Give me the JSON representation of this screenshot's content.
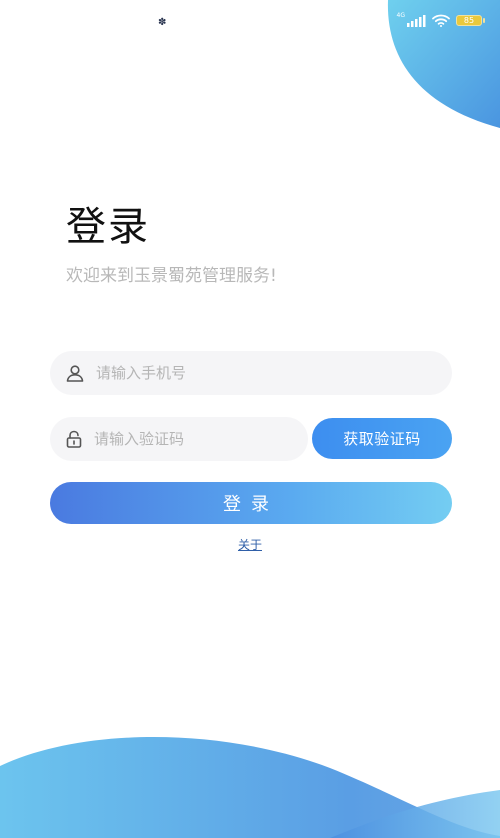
{
  "status_bar": {
    "left_indicator": "✽",
    "network_label": "4G",
    "battery_level": "85",
    "icons": [
      "signal-icon",
      "wifi-icon",
      "battery-icon"
    ]
  },
  "login": {
    "title": "登录",
    "subtitle": "欢迎来到玉景蜀苑管理服务!",
    "phone_field": {
      "placeholder": "请输入手机号",
      "value": "",
      "icon": "user-icon"
    },
    "code_field": {
      "placeholder": "请输入验证码",
      "value": "",
      "icon": "lock-icon"
    },
    "get_code_label": "获取验证码",
    "login_label": "登录",
    "about_label": "关于"
  },
  "colors": {
    "accent": "#3d8ef0",
    "gradient_start": "#4a7ae0",
    "gradient_end": "#74cdf2",
    "link": "#2f5fa8",
    "battery": "#e9c93e"
  }
}
